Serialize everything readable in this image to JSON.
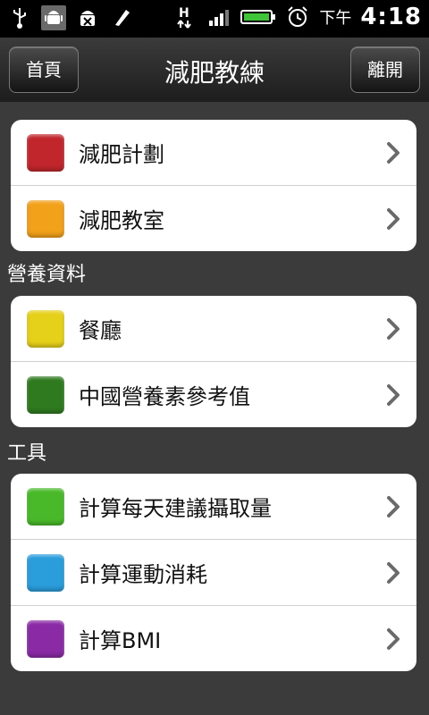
{
  "status": {
    "time_prefix": "下午",
    "time": "4:18"
  },
  "header": {
    "title": "減肥教練",
    "left_button": "首頁",
    "right_button": "離開"
  },
  "groups": [
    {
      "header": "",
      "items": [
        {
          "label": "減肥計劃",
          "color": "#c0262c"
        },
        {
          "label": "減肥教室",
          "color": "#f2a11a"
        }
      ]
    },
    {
      "header": "營養資料",
      "items": [
        {
          "label": "餐廳",
          "color": "#e6d11a"
        },
        {
          "label": "中國營養素參考值",
          "color": "#2f7a1f"
        }
      ]
    },
    {
      "header": "工具",
      "items": [
        {
          "label": "計算每天建議攝取量",
          "color": "#49b92a"
        },
        {
          "label": "計算運動消耗",
          "color": "#2a9ddb"
        },
        {
          "label": "計算BMI",
          "color": "#8a2aa5"
        }
      ]
    }
  ]
}
